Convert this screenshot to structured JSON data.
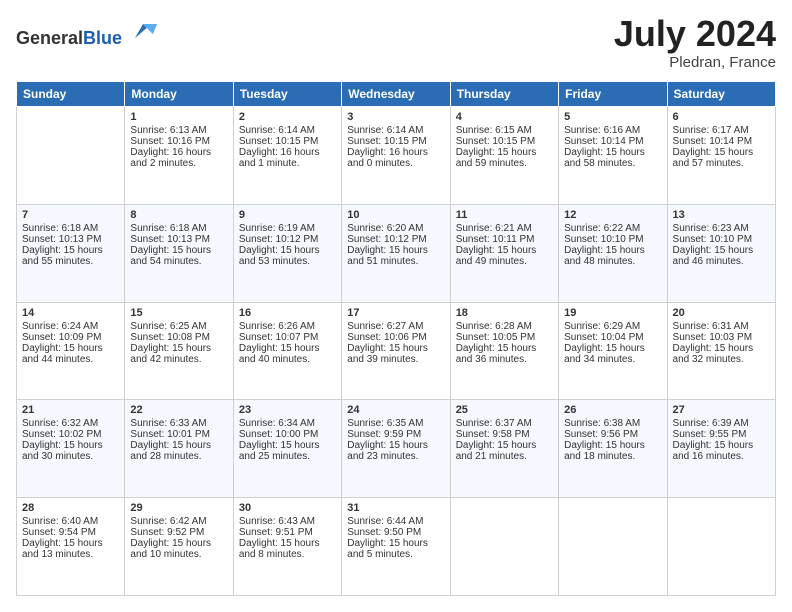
{
  "header": {
    "logo_general": "General",
    "logo_blue": "Blue",
    "title": "July 2024",
    "location": "Pledran, France"
  },
  "weekdays": [
    "Sunday",
    "Monday",
    "Tuesday",
    "Wednesday",
    "Thursday",
    "Friday",
    "Saturday"
  ],
  "weeks": [
    [
      {
        "day": "",
        "sunrise": "",
        "sunset": "",
        "daylight": ""
      },
      {
        "day": "1",
        "sunrise": "Sunrise: 6:13 AM",
        "sunset": "Sunset: 10:16 PM",
        "daylight": "Daylight: 16 hours and 2 minutes."
      },
      {
        "day": "2",
        "sunrise": "Sunrise: 6:14 AM",
        "sunset": "Sunset: 10:15 PM",
        "daylight": "Daylight: 16 hours and 1 minute."
      },
      {
        "day": "3",
        "sunrise": "Sunrise: 6:14 AM",
        "sunset": "Sunset: 10:15 PM",
        "daylight": "Daylight: 16 hours and 0 minutes."
      },
      {
        "day": "4",
        "sunrise": "Sunrise: 6:15 AM",
        "sunset": "Sunset: 10:15 PM",
        "daylight": "Daylight: 15 hours and 59 minutes."
      },
      {
        "day": "5",
        "sunrise": "Sunrise: 6:16 AM",
        "sunset": "Sunset: 10:14 PM",
        "daylight": "Daylight: 15 hours and 58 minutes."
      },
      {
        "day": "6",
        "sunrise": "Sunrise: 6:17 AM",
        "sunset": "Sunset: 10:14 PM",
        "daylight": "Daylight: 15 hours and 57 minutes."
      }
    ],
    [
      {
        "day": "7",
        "sunrise": "Sunrise: 6:18 AM",
        "sunset": "Sunset: 10:13 PM",
        "daylight": "Daylight: 15 hours and 55 minutes."
      },
      {
        "day": "8",
        "sunrise": "Sunrise: 6:18 AM",
        "sunset": "Sunset: 10:13 PM",
        "daylight": "Daylight: 15 hours and 54 minutes."
      },
      {
        "day": "9",
        "sunrise": "Sunrise: 6:19 AM",
        "sunset": "Sunset: 10:12 PM",
        "daylight": "Daylight: 15 hours and 53 minutes."
      },
      {
        "day": "10",
        "sunrise": "Sunrise: 6:20 AM",
        "sunset": "Sunset: 10:12 PM",
        "daylight": "Daylight: 15 hours and 51 minutes."
      },
      {
        "day": "11",
        "sunrise": "Sunrise: 6:21 AM",
        "sunset": "Sunset: 10:11 PM",
        "daylight": "Daylight: 15 hours and 49 minutes."
      },
      {
        "day": "12",
        "sunrise": "Sunrise: 6:22 AM",
        "sunset": "Sunset: 10:10 PM",
        "daylight": "Daylight: 15 hours and 48 minutes."
      },
      {
        "day": "13",
        "sunrise": "Sunrise: 6:23 AM",
        "sunset": "Sunset: 10:10 PM",
        "daylight": "Daylight: 15 hours and 46 minutes."
      }
    ],
    [
      {
        "day": "14",
        "sunrise": "Sunrise: 6:24 AM",
        "sunset": "Sunset: 10:09 PM",
        "daylight": "Daylight: 15 hours and 44 minutes."
      },
      {
        "day": "15",
        "sunrise": "Sunrise: 6:25 AM",
        "sunset": "Sunset: 10:08 PM",
        "daylight": "Daylight: 15 hours and 42 minutes."
      },
      {
        "day": "16",
        "sunrise": "Sunrise: 6:26 AM",
        "sunset": "Sunset: 10:07 PM",
        "daylight": "Daylight: 15 hours and 40 minutes."
      },
      {
        "day": "17",
        "sunrise": "Sunrise: 6:27 AM",
        "sunset": "Sunset: 10:06 PM",
        "daylight": "Daylight: 15 hours and 39 minutes."
      },
      {
        "day": "18",
        "sunrise": "Sunrise: 6:28 AM",
        "sunset": "Sunset: 10:05 PM",
        "daylight": "Daylight: 15 hours and 36 minutes."
      },
      {
        "day": "19",
        "sunrise": "Sunrise: 6:29 AM",
        "sunset": "Sunset: 10:04 PM",
        "daylight": "Daylight: 15 hours and 34 minutes."
      },
      {
        "day": "20",
        "sunrise": "Sunrise: 6:31 AM",
        "sunset": "Sunset: 10:03 PM",
        "daylight": "Daylight: 15 hours and 32 minutes."
      }
    ],
    [
      {
        "day": "21",
        "sunrise": "Sunrise: 6:32 AM",
        "sunset": "Sunset: 10:02 PM",
        "daylight": "Daylight: 15 hours and 30 minutes."
      },
      {
        "day": "22",
        "sunrise": "Sunrise: 6:33 AM",
        "sunset": "Sunset: 10:01 PM",
        "daylight": "Daylight: 15 hours and 28 minutes."
      },
      {
        "day": "23",
        "sunrise": "Sunrise: 6:34 AM",
        "sunset": "Sunset: 10:00 PM",
        "daylight": "Daylight: 15 hours and 25 minutes."
      },
      {
        "day": "24",
        "sunrise": "Sunrise: 6:35 AM",
        "sunset": "Sunset: 9:59 PM",
        "daylight": "Daylight: 15 hours and 23 minutes."
      },
      {
        "day": "25",
        "sunrise": "Sunrise: 6:37 AM",
        "sunset": "Sunset: 9:58 PM",
        "daylight": "Daylight: 15 hours and 21 minutes."
      },
      {
        "day": "26",
        "sunrise": "Sunrise: 6:38 AM",
        "sunset": "Sunset: 9:56 PM",
        "daylight": "Daylight: 15 hours and 18 minutes."
      },
      {
        "day": "27",
        "sunrise": "Sunrise: 6:39 AM",
        "sunset": "Sunset: 9:55 PM",
        "daylight": "Daylight: 15 hours and 16 minutes."
      }
    ],
    [
      {
        "day": "28",
        "sunrise": "Sunrise: 6:40 AM",
        "sunset": "Sunset: 9:54 PM",
        "daylight": "Daylight: 15 hours and 13 minutes."
      },
      {
        "day": "29",
        "sunrise": "Sunrise: 6:42 AM",
        "sunset": "Sunset: 9:52 PM",
        "daylight": "Daylight: 15 hours and 10 minutes."
      },
      {
        "day": "30",
        "sunrise": "Sunrise: 6:43 AM",
        "sunset": "Sunset: 9:51 PM",
        "daylight": "Daylight: 15 hours and 8 minutes."
      },
      {
        "day": "31",
        "sunrise": "Sunrise: 6:44 AM",
        "sunset": "Sunset: 9:50 PM",
        "daylight": "Daylight: 15 hours and 5 minutes."
      },
      {
        "day": "",
        "sunrise": "",
        "sunset": "",
        "daylight": ""
      },
      {
        "day": "",
        "sunrise": "",
        "sunset": "",
        "daylight": ""
      },
      {
        "day": "",
        "sunrise": "",
        "sunset": "",
        "daylight": ""
      }
    ]
  ]
}
